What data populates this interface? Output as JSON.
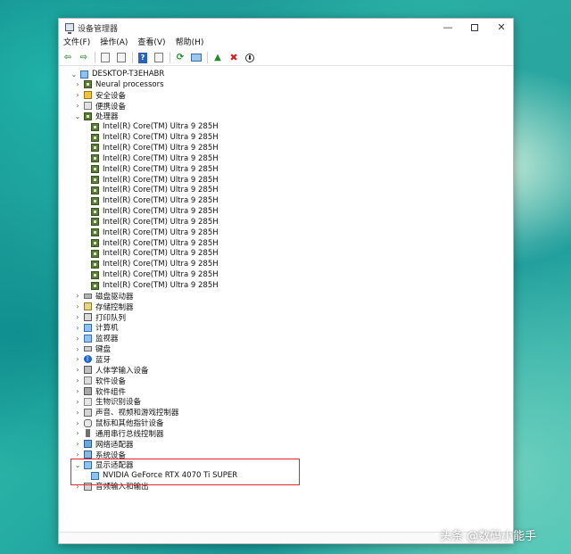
{
  "window": {
    "title": "设备管理器",
    "controls": {
      "minimize": "—",
      "close": "✕"
    }
  },
  "menu": [
    "文件(F)",
    "操作(A)",
    "查看(V)",
    "帮助(H)"
  ],
  "toolbar": [
    {
      "icon": "back-arrow-icon",
      "glyph": "⇦"
    },
    {
      "icon": "forward-arrow-icon",
      "glyph": "⇨"
    },
    {
      "icon": "properties-icon",
      "glyph": ""
    },
    {
      "icon": "update-driver-icon",
      "glyph": ""
    },
    {
      "icon": "help-icon",
      "glyph": "?"
    },
    {
      "icon": "driver-details-icon",
      "glyph": ""
    },
    {
      "icon": "scan-hardware-icon",
      "glyph": "⟳"
    },
    {
      "icon": "monitor-icon",
      "glyph": ""
    },
    {
      "icon": "add-driver-icon",
      "glyph": "▲"
    },
    {
      "icon": "uninstall-icon",
      "glyph": "✖"
    },
    {
      "icon": "download-icon",
      "glyph": "⬇"
    }
  ],
  "tree": {
    "root": "DESKTOP-T3EHABR",
    "items": [
      {
        "label": "Neural processors",
        "icon": "chip-icon",
        "expanded": false
      },
      {
        "label": "安全设备",
        "icon": "security-key-icon",
        "expanded": false
      },
      {
        "label": "便携设备",
        "icon": "portable-device-icon",
        "expanded": false
      },
      {
        "label": "处理器",
        "icon": "processor-icon",
        "expanded": true,
        "children_label": "Intel(R) Core(TM) Ultra 9 285H",
        "children_count": 16
      },
      {
        "label": "磁盘驱动器",
        "icon": "disk-icon",
        "expanded": false
      },
      {
        "label": "存储控制器",
        "icon": "storage-controller-icon",
        "expanded": false
      },
      {
        "label": "打印队列",
        "icon": "printer-icon",
        "expanded": false
      },
      {
        "label": "计算机",
        "icon": "computer-icon",
        "expanded": false
      },
      {
        "label": "监视器",
        "icon": "monitor-icon",
        "expanded": false
      },
      {
        "label": "键盘",
        "icon": "keyboard-icon",
        "expanded": false
      },
      {
        "label": "蓝牙",
        "icon": "bluetooth-icon",
        "expanded": false
      },
      {
        "label": "人体学输入设备",
        "icon": "hid-icon",
        "expanded": false
      },
      {
        "label": "软件设备",
        "icon": "software-device-icon",
        "expanded": false
      },
      {
        "label": "软件组件",
        "icon": "software-component-icon",
        "expanded": false
      },
      {
        "label": "生物识别设备",
        "icon": "biometric-icon",
        "expanded": false
      },
      {
        "label": "声音、视频和游戏控制器",
        "icon": "audio-icon",
        "expanded": false
      },
      {
        "label": "鼠标和其他指针设备",
        "icon": "mouse-icon",
        "expanded": false
      },
      {
        "label": "通用串行总线控制器",
        "icon": "usb-icon",
        "expanded": false
      },
      {
        "label": "网络适配器",
        "icon": "network-adapter-icon",
        "expanded": false
      },
      {
        "label": "系统设备",
        "icon": "system-device-icon",
        "expanded": false
      },
      {
        "label": "显示适配器",
        "icon": "display-adapter-icon",
        "expanded": true,
        "children": [
          "NVIDIA GeForce RTX 4070 Ti SUPER"
        ]
      },
      {
        "label": "音频输入和输出",
        "icon": "audio-io-icon",
        "expanded": false
      }
    ]
  },
  "watermark": "头条 @数码小能手"
}
